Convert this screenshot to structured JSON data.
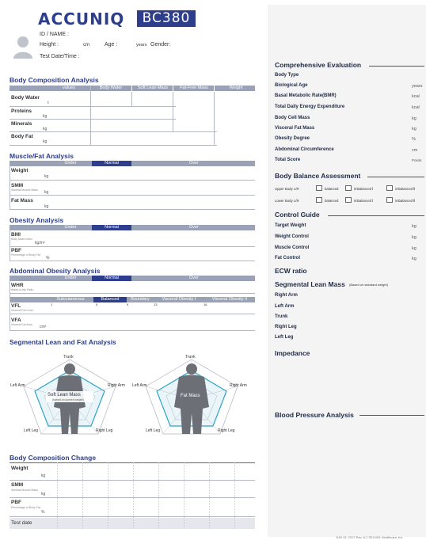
{
  "header": {
    "brand": "ACCUNIQ",
    "model": "BC380",
    "id_label": "ID / NAME :",
    "height_label": "Height :",
    "height_unit": "cm",
    "age_label": "Age :",
    "age_unit": "years",
    "gender_label": "Gender:",
    "date_label": "Test Date/Time :"
  },
  "body_composition": {
    "title": "Body Composition Analysis",
    "columns": [
      "values",
      "Body Water",
      "Soft Lean Mass",
      "Fat-Free Mass",
      "Weight"
    ],
    "rows": [
      {
        "label": "Body Water",
        "unit": "ℓ"
      },
      {
        "label": "Proteins",
        "unit": "kg"
      },
      {
        "label": "Minerals",
        "unit": "kg"
      },
      {
        "label": "Body Fat",
        "unit": "kg"
      }
    ]
  },
  "muscle_fat": {
    "title": "Muscle/Fat Analysis",
    "scale": [
      "Under",
      "Normal",
      "Over"
    ],
    "rows": [
      {
        "label": "Weight",
        "sub": "",
        "unit": "kg"
      },
      {
        "label": "SMM",
        "sub": "Skeletal Muscle Mass",
        "unit": "kg"
      },
      {
        "label": "Fat Mass",
        "sub": "",
        "unit": "kg"
      }
    ]
  },
  "obesity": {
    "title": "Obesity Analysis",
    "scale": [
      "Under",
      "Normal",
      "Over"
    ],
    "rows": [
      {
        "label": "BMI",
        "sub": "Body Mass Index",
        "unit": "kg/m²"
      },
      {
        "label": "PBF",
        "sub": "Percentage of Body Fat",
        "unit": "%"
      }
    ]
  },
  "abdominal": {
    "title": "Abdominal Obesity Analysis",
    "scale": [
      "Under",
      "Normal",
      "Over"
    ],
    "whr": {
      "label": "WHR",
      "sub": "Waist-to-Hip Ratio"
    },
    "vfl_scale": [
      "Subcutaneous",
      "Balanced",
      "Boundary",
      "Visceral Obesity I",
      "Visceral Obesity II"
    ],
    "vfl_ticks": [
      "1",
      "5",
      "9",
      "13",
      "16"
    ],
    "rows": [
      {
        "label": "VFL",
        "sub": "Visceral Fat Level",
        "unit": ""
      },
      {
        "label": "VFA",
        "sub": "Visceral Fat Area",
        "unit": "cm²"
      }
    ]
  },
  "segmental": {
    "title": "Segmental Lean and Fat Analysis",
    "left_chart": {
      "top": "Trunk",
      "left_arm": "Left Arm",
      "right_arm": "Right Arm",
      "left_leg": "Left Leg",
      "right_leg": "Right Leg",
      "center": "Soft Lean Mass",
      "center_sub": "(based on current weight)"
    },
    "right_chart": {
      "top": "Trunk",
      "left_arm": "Left Arm",
      "right_arm": "Right Arm",
      "left_leg": "Left Leg",
      "right_leg": "Right Leg",
      "center": "Fat Mass"
    }
  },
  "change": {
    "title": "Body Composition Change",
    "rows": [
      {
        "label": "Weight",
        "sub": "",
        "unit": "kg"
      },
      {
        "label": "SMM",
        "sub": "Skeletal Muscle Mass",
        "unit": "kg"
      },
      {
        "label": "PBF",
        "sub": "Percentage of Body Fat",
        "unit": "%"
      }
    ],
    "test_date": "Test date"
  },
  "comprehensive": {
    "title": "Comprehensive Evaluation",
    "items": [
      {
        "label": "Body Type",
        "unit": ""
      },
      {
        "label": "Biological Age",
        "unit": "years"
      },
      {
        "label": "Basal Metabolic Rate(BMR)",
        "unit": "kcal"
      },
      {
        "label": "Total Daily Energy Expenditure",
        "unit": "kcal"
      },
      {
        "label": "Body Cell Mass",
        "unit": "kg"
      },
      {
        "label": "Visceral Fat Mass",
        "unit": "kg"
      },
      {
        "label": "Obesity Degree",
        "unit": "%"
      },
      {
        "label": "Abdominal Circumference",
        "unit": "cm"
      },
      {
        "label": "Total Score",
        "unit": "Points"
      }
    ]
  },
  "balance": {
    "title": "Body Balance Assessment",
    "rows": [
      {
        "label": "Upper Body L/R",
        "opts": [
          "balanced",
          "imbalanced Ⅰ",
          "imbalanced Ⅱ"
        ]
      },
      {
        "label": "Lower Body L/R",
        "opts": [
          "balanced",
          "imbalanced Ⅰ",
          "imbalanced Ⅱ"
        ]
      }
    ]
  },
  "control": {
    "title": "Control Guide",
    "items": [
      {
        "label": "Target Weight",
        "unit": "kg"
      },
      {
        "label": "Weight Control",
        "unit": "kg"
      },
      {
        "label": "Muscle Control",
        "unit": "kg"
      },
      {
        "label": "Fat Control",
        "unit": "kg"
      }
    ]
  },
  "ecw": {
    "title": "ECW ratio"
  },
  "segmental_lean": {
    "title": "Segmental Lean Mass",
    "note": "(Based on standard weight)",
    "items": [
      "Right Arm",
      "Left Arm",
      "Trunk",
      "Right Leg",
      "Left Leg"
    ]
  },
  "impedance": {
    "title": "Impedance"
  },
  "blood_pressure": {
    "title": "Blood Pressure Analysis"
  },
  "footer": "JUN 15, 2017 Rev. A.2  SELVAS Healthcare, Inc."
}
